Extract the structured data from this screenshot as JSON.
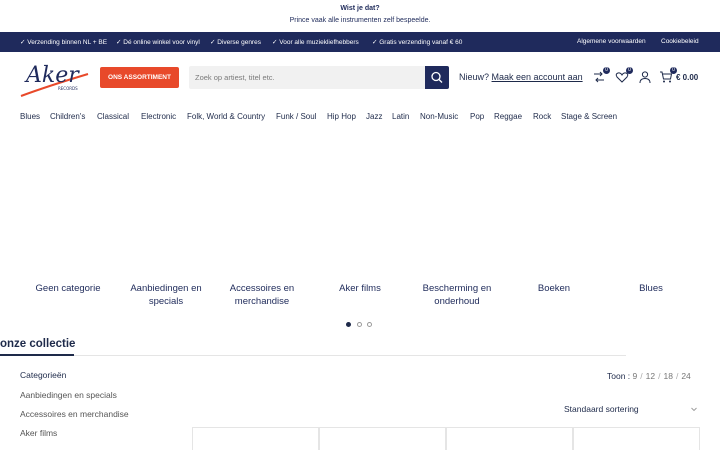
{
  "notice": {
    "title": "Wist je dat?",
    "text": "Prince vaak alle instrumenten zelf bespeelde."
  },
  "topbar": {
    "usps": [
      "✓ Verzending binnen NL + BE",
      "✓ Dé online winkel voor vinyl",
      "✓ Diverse genres",
      "✓ Voor alle muziekliefhebbers",
      "✓ Gratis verzending vanaf € 60"
    ],
    "links": [
      "Algemene voorwaarden",
      "Cookiebeleid"
    ]
  },
  "header": {
    "logo_text": "Aker",
    "logo_sub": "RECORDS",
    "assortment_label": "ONS ASSORTIMENT",
    "search_placeholder": "Zoek op artiest, titel etc.",
    "account_prefix": "Nieuw?",
    "account_link": "Maak een account aan",
    "compare_count": "0",
    "wishlist_count": "0",
    "cart_count": "0",
    "cart_total": "€ 0.00"
  },
  "categories": [
    "Blues",
    "Children's",
    "Classical",
    "Electronic",
    "Folk, World & Country",
    "Funk / Soul",
    "Hip Hop",
    "Jazz",
    "Latin",
    "Non-Music",
    "Pop",
    "Reggae",
    "Rock",
    "Stage & Screen"
  ],
  "carousel": {
    "items": [
      "Geen categorie",
      "Aanbiedingen en specials",
      "Accessoires en merchandise",
      "Aker films",
      "Bescherming en onderhoud",
      "Boeken",
      "Blues"
    ],
    "active_dot": 0
  },
  "collection": {
    "title": "onze collectie",
    "sidebar_title": "Categorieën",
    "sidebar_items": [
      "Aanbiedingen en specials",
      "Accessoires en merchandise",
      "Aker films"
    ],
    "show_label": "Toon :",
    "show_options": [
      "9",
      "12",
      "18",
      "24"
    ],
    "sort_label": "Standaard sortering"
  },
  "colors": {
    "navy": "#1f2a5c",
    "orange": "#e8492a"
  }
}
